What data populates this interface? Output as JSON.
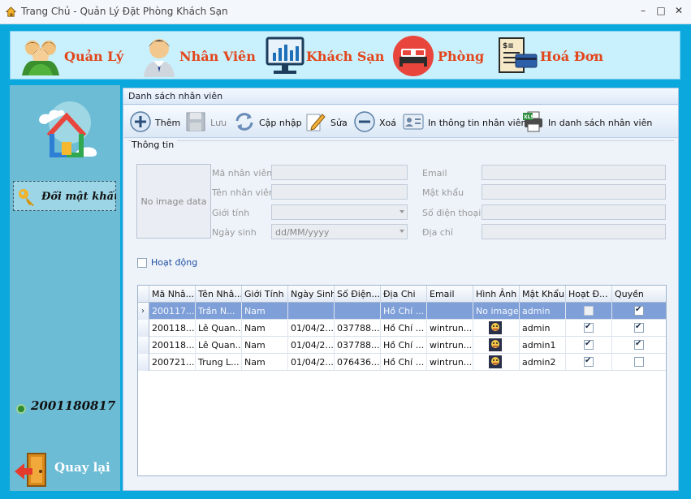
{
  "window": {
    "title": "Trang Chủ - Quản Lý Đặt Phòng Khách Sạn",
    "minimize": "–",
    "maximize": "□",
    "close": "✕"
  },
  "menu": [
    {
      "label": "Quản Lý"
    },
    {
      "label": "Nhân Viên"
    },
    {
      "label": "Khách Sạn"
    },
    {
      "label": "Phòng"
    },
    {
      "label": "Hoá Đơn"
    }
  ],
  "sidebar": {
    "change_password": "Đổi mật khẩu",
    "user_id": "2001180817",
    "back": "Quay lại"
  },
  "panel": {
    "title": "Danh sách nhân viên"
  },
  "toolbar": {
    "add": "Thêm",
    "save": "Lưu",
    "update": "Cập nhập",
    "edit": "Sửa",
    "delete": "Xoá",
    "print_info": "In thông tin nhân viên",
    "print_list": "In danh sách nhân viên"
  },
  "info": {
    "group_title": "Thông tin",
    "no_image": "No image data",
    "labels": {
      "id": "Mã nhân viên",
      "name": "Tên nhân viên",
      "gender": "Giới tính",
      "birth": "Ngày sinh",
      "email": "Email",
      "password": "Mật khẩu",
      "phone": "Số điện thoại",
      "address": "Địa chỉ"
    },
    "birth_placeholder": "dd/MM/yyyy",
    "active_label": "Hoạt động"
  },
  "grid": {
    "headers": [
      "Mã Nhâ...",
      "Tên Nhâ...",
      "Giới Tính",
      "Ngày Sinh",
      "Số Điện...",
      "Địa Chi",
      "Email",
      "Hình Ảnh",
      "Mật Khẩu",
      "Hoạt Đ...",
      "Quyền"
    ],
    "rows": [
      {
        "id": "200117...",
        "name": "Trần N...",
        "gender": "Nam",
        "birth": "",
        "phone": "",
        "address": "Hồ Chí ...",
        "email": "",
        "image": "No image...",
        "password": "admin",
        "active": false,
        "role": true,
        "selected": true,
        "avatar": false
      },
      {
        "id": "200118...",
        "name": "Lê Quan...",
        "gender": "Nam",
        "birth": "01/04/2...",
        "phone": "037788...",
        "address": "Hồ Chí ...",
        "email": "wintrun...",
        "image": "",
        "password": "admin",
        "active": true,
        "role": true,
        "selected": false,
        "avatar": true
      },
      {
        "id": "200118...",
        "name": "Lê Quan...",
        "gender": "Nam",
        "birth": "01/04/2...",
        "phone": "037788...",
        "address": "Hồ Chí ...",
        "email": "wintrun...",
        "image": "",
        "password": "admin1",
        "active": true,
        "role": true,
        "selected": false,
        "avatar": true
      },
      {
        "id": "200721...",
        "name": "Trung L...",
        "gender": "Nam",
        "birth": "01/04/2...",
        "phone": "076436...",
        "address": "Hồ Chí ...",
        "email": "wintrun...",
        "image": "",
        "password": "admin2",
        "active": true,
        "role": false,
        "selected": false,
        "avatar": true
      }
    ]
  }
}
